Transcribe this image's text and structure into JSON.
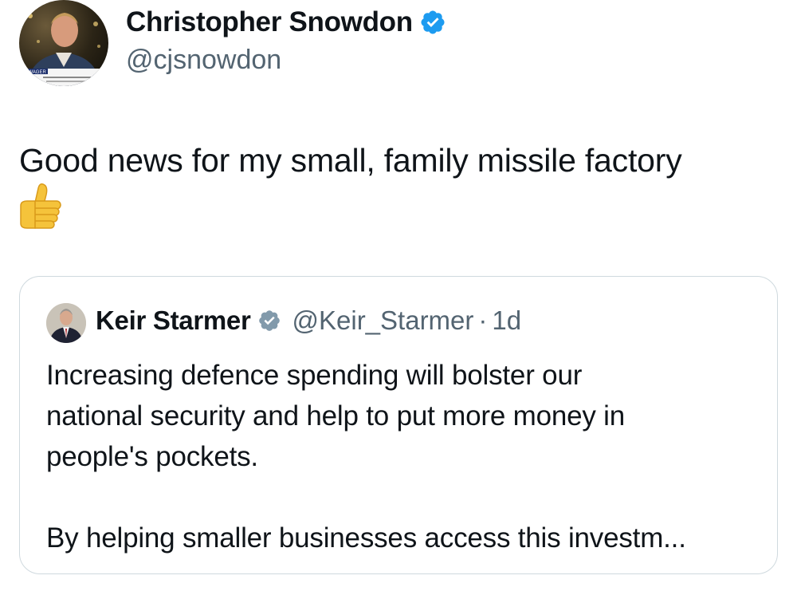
{
  "author": {
    "name": "Christopher Snowdon",
    "handle": "@cjsnowdon",
    "avatar_caption": "TS WAGER"
  },
  "tweet": {
    "text": "Good news for my small, family missile factory",
    "emoji": "thumbs-up"
  },
  "quoted": {
    "name": "Keir Starmer",
    "handle": "@Keir_Starmer",
    "separator": "·",
    "time": "1d",
    "badge_color": "#829aab",
    "lines": [
      "Increasing defence spending will bolster our",
      "national security and help to put more money in",
      "people's pockets."
    ],
    "last_line": "By helping smaller businesses access this investm..."
  },
  "colors": {
    "verified_blue": "#1d9bf0",
    "secondary_text": "#536471",
    "border": "#cfd9de"
  }
}
